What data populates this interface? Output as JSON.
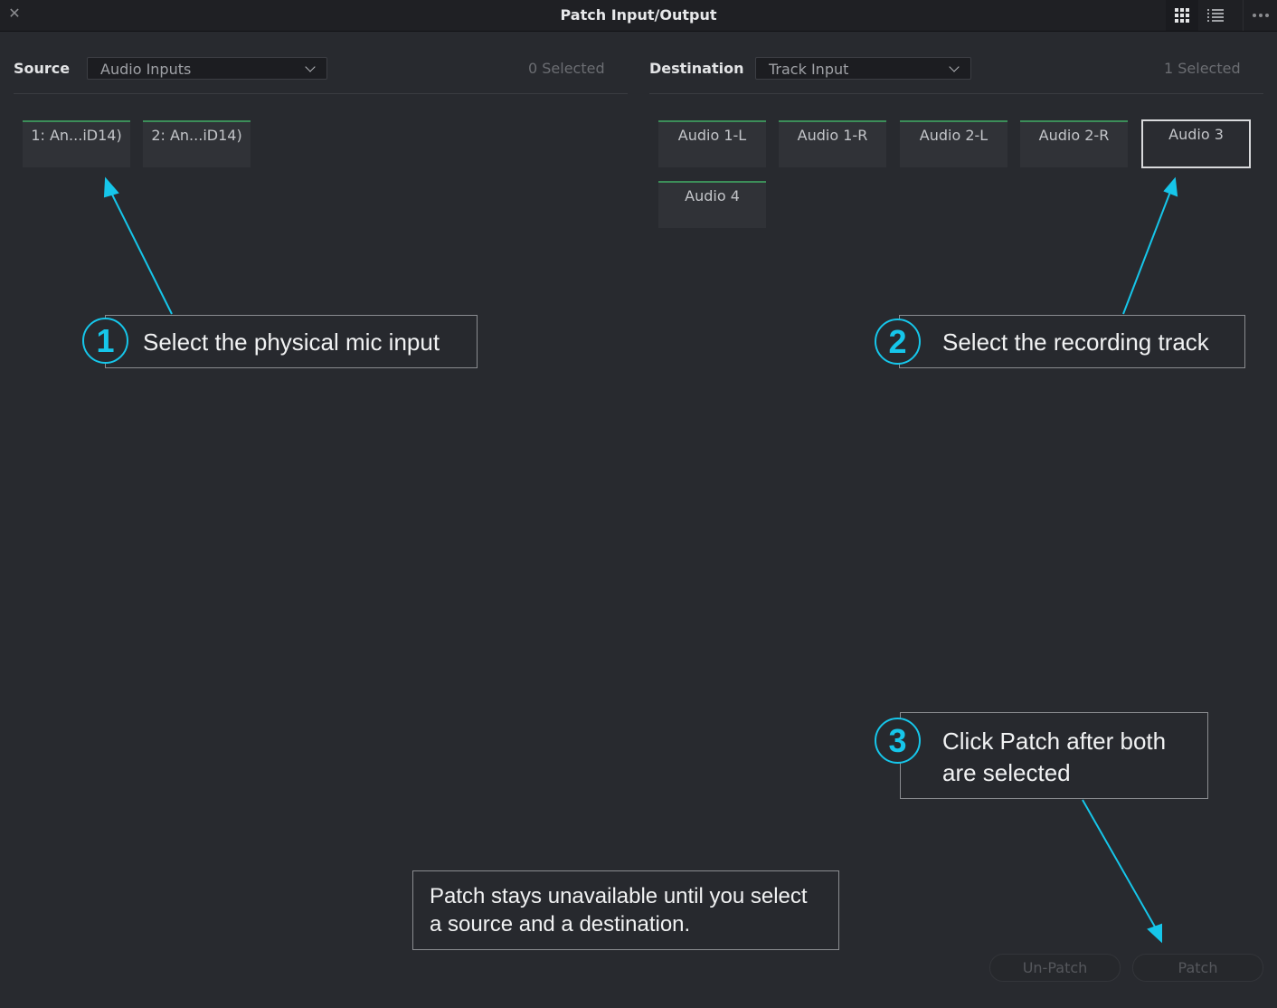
{
  "window": {
    "title": "Patch Input/Output",
    "close_glyph": "✕"
  },
  "source": {
    "label": "Source",
    "dropdown_value": "Audio Inputs",
    "selected_count": "0 Selected",
    "tiles": [
      "1: An...iD14)",
      "2: An...iD14)"
    ]
  },
  "destination": {
    "label": "Destination",
    "dropdown_value": "Track Input",
    "selected_count": "1 Selected",
    "tiles": [
      "Audio 1-L",
      "Audio 1-R",
      "Audio 2-L",
      "Audio 2-R",
      "Audio 3",
      "Audio 4"
    ],
    "selected_tile": "Audio 3"
  },
  "callouts": [
    {
      "number": "1",
      "text": "Select the physical mic input"
    },
    {
      "number": "2",
      "text": "Select the recording track"
    },
    {
      "number": "3",
      "line1": "Click Patch after both",
      "line2": "are selected"
    }
  ],
  "note": {
    "line1": "Patch stays unavailable until you select",
    "line2": "a source and a destination."
  },
  "buttons": {
    "unpatch": "Un-Patch",
    "patch": "Patch"
  },
  "colors": {
    "accent_cyan": "#16c6ea",
    "tile_top_green": "#3c8e59",
    "background": "#282a2f"
  }
}
